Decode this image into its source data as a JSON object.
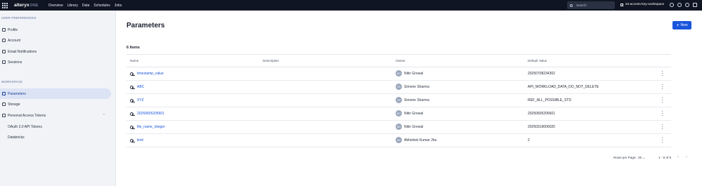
{
  "app": {
    "logo": "alteryx",
    "logo_suffix": "ONE"
  },
  "nav": [
    "Overview",
    "Library",
    "Data",
    "Schedules",
    "Jobs"
  ],
  "search": {
    "placeholder": "Search"
  },
  "workspace": "s3-access-key-workspace",
  "sidebar": {
    "user_prefs_title": "USER PREFERENCES",
    "workspace_title": "WORKSPACE",
    "items": [
      {
        "label": "Profile",
        "icon": "user-icon"
      },
      {
        "label": "Account",
        "icon": "account-card-icon"
      },
      {
        "label": "Email Notifications",
        "icon": "mail-icon"
      },
      {
        "label": "Sessions",
        "icon": "sessions-icon"
      },
      {
        "label": "Parameters",
        "icon": "parameters-icon"
      },
      {
        "label": "Storage",
        "icon": "storage-icon"
      },
      {
        "label": "Personal Access Tokens",
        "icon": "key-icon"
      },
      {
        "label": "OAuth 2.0 API Tokens"
      },
      {
        "label": "Databricks"
      }
    ]
  },
  "page": {
    "title": "Parameters",
    "new_button": "New",
    "count": "6 Items"
  },
  "table": {
    "headers": [
      "Name",
      "Description",
      "Owner",
      "Default Value"
    ],
    "rows": [
      {
        "name": "timestamp_value",
        "description": "",
        "owner": "Nitin Grewal",
        "initials": "NG",
        "default": "20250708234302"
      },
      {
        "name": "ABC",
        "description": "",
        "owner": "Simone Sharma",
        "initials": "SS",
        "default": "API_WORKLOAD_DATA_DO_NOT_DELETE"
      },
      {
        "name": "XYZ",
        "description": "",
        "owner": "Simone Sharma",
        "initials": "SS",
        "default": "REF_ALL_POSSIBLE_STD"
      },
      {
        "name": "20250605205601",
        "description": "",
        "owner": "Nitin Grewal",
        "initials": "NG",
        "default": "20250605205601"
      },
      {
        "name": "file_name_integer",
        "description": "",
        "owner": "Nitin Grewal",
        "initials": "NG",
        "default": "20250319000020"
      },
      {
        "name": "limit",
        "description": "",
        "owner": "Abhishek Kumar Jha",
        "initials": "AK",
        "default": "2"
      }
    ]
  },
  "pagination": {
    "rows_label": "Rows per Page:",
    "rows_value": "25",
    "range": "1 - 6 of 6"
  }
}
